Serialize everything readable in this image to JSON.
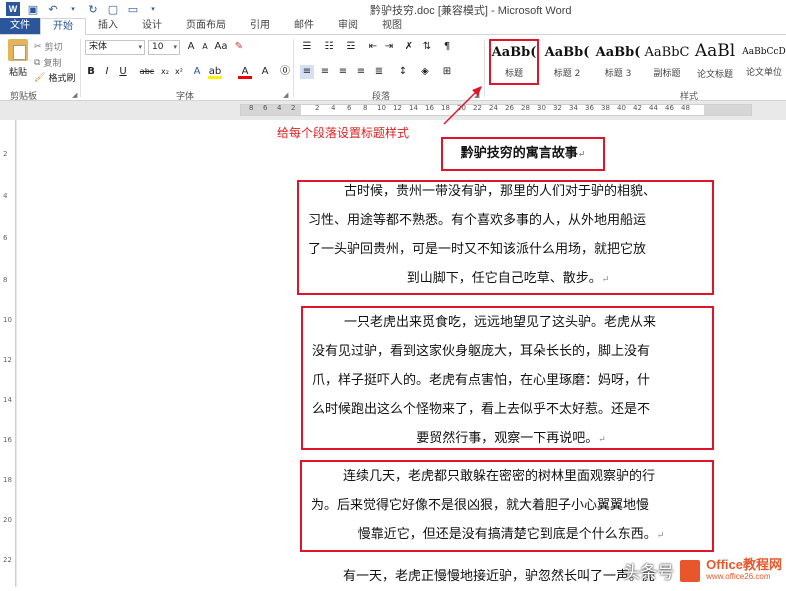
{
  "window": {
    "title": "黔驴技穷.doc [兼容模式] - Microsoft Word"
  },
  "qat": {
    "undo_icon": "undo-icon",
    "redo_icon": "redo-icon"
  },
  "tabs": [
    {
      "label": "文件"
    },
    {
      "label": "开始"
    },
    {
      "label": "插入"
    },
    {
      "label": "设计"
    },
    {
      "label": "页面布局"
    },
    {
      "label": "引用"
    },
    {
      "label": "邮件"
    },
    {
      "label": "审阅"
    },
    {
      "label": "视图"
    }
  ],
  "ribbon": {
    "clipboard": {
      "paste": "粘贴",
      "cut": "剪切",
      "copy": "复制",
      "format_painter": "格式刷",
      "group": "剪贴板"
    },
    "font": {
      "name": "宋体",
      "size": "10",
      "group": "字体"
    },
    "paragraph": {
      "group": "段落"
    },
    "styles": {
      "group": "样式",
      "items": [
        {
          "sample": "AaBb(",
          "name": "标题"
        },
        {
          "sample": "AaBb(",
          "name": "标题 2"
        },
        {
          "sample": "AaBb(",
          "name": "标题 3"
        },
        {
          "sample": "AaBbC",
          "name": "副标题"
        },
        {
          "sample": "AaBl",
          "name": "论文标题"
        },
        {
          "sample": "AaBbCcD",
          "name": "论文单位"
        }
      ]
    }
  },
  "ruler": {
    "left_nums": [
      "8",
      "6",
      "4",
      "2"
    ],
    "right_nums": [
      "2",
      "4",
      "6",
      "8",
      "10",
      "12",
      "14",
      "16",
      "18",
      "20",
      "22",
      "24",
      "26",
      "28",
      "30",
      "32",
      "34",
      "36",
      "38",
      "40",
      "42",
      "44",
      "46",
      "48"
    ]
  },
  "vruler": {
    "nums": [
      "2",
      "4",
      "6",
      "8",
      "10",
      "12",
      "14",
      "16",
      "18",
      "20",
      "22"
    ]
  },
  "annotation": "给每个段落设置标题样式",
  "document": {
    "title": "黔驴技穷的寓言故事",
    "para1": {
      "lines": [
        "古时候，贵州一带没有驴，那里的人们对于驴的相貌、",
        "习性、用途等都不熟悉。有个喜欢多事的人，从外地用船运",
        "了一头驴回贵州，可是一时又不知该派什么用场，就把它放",
        "到山脚下，任它自己吃草、散步。"
      ]
    },
    "para2": {
      "lines": [
        "一只老虎出来觅食吃，远远地望见了这头驴。老虎从来",
        "没有见过驴，看到这家伙身躯庞大，耳朵长长的，脚上没有",
        "爪，样子挺吓人的。老虎有点害怕，在心里琢磨：妈呀，什",
        "么时候跑出这么个怪物来了，看上去似乎不太好惹。还是不",
        "要贸然行事，观察一下再说吧。"
      ]
    },
    "para3": {
      "lines": [
        "连续几天，老虎都只敢躲在密密的树林里面观察驴的行",
        "为。后来觉得它好像不是很凶狠，就大着胆子小心翼翼地慢",
        "慢靠近它，但还是没有搞清楚它到底是个什么东西。"
      ]
    },
    "para4": {
      "line": "有一天，老虎正慢慢地接近驴，驴忽然长叫了一声。虎"
    }
  },
  "watermark": {
    "left": "头条号",
    "brand": "Office教程网",
    "url": "www.office26.com"
  }
}
